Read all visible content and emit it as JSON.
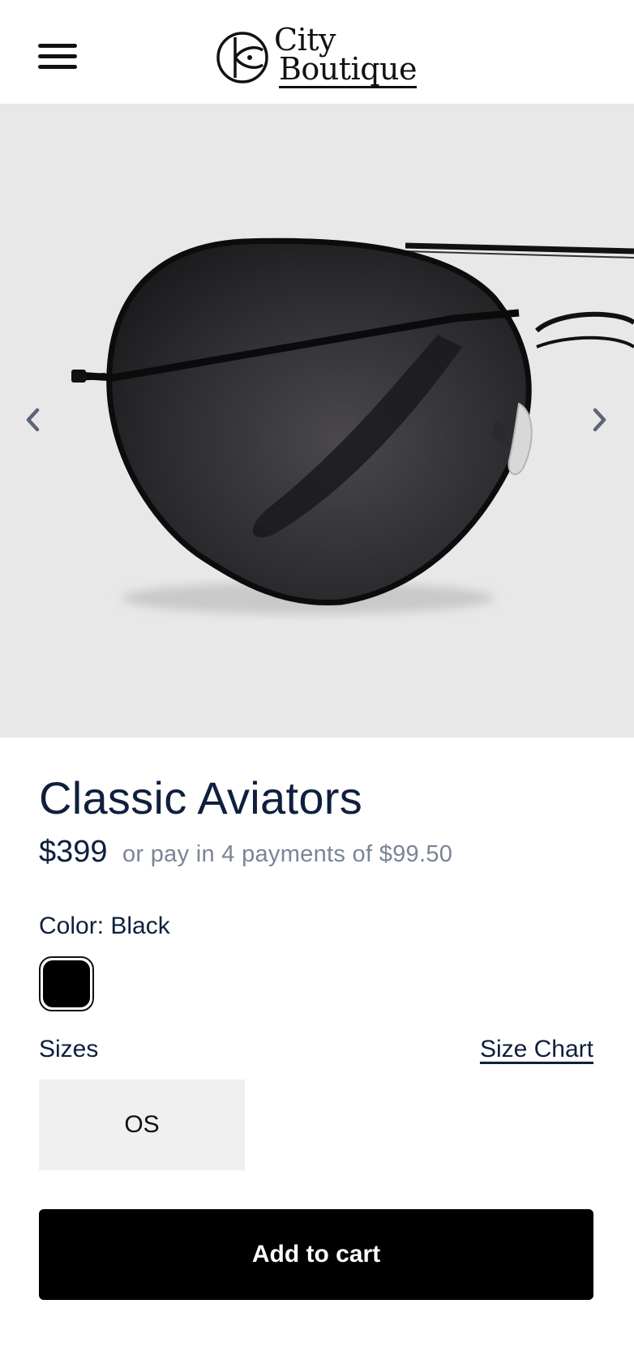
{
  "header": {
    "menu_icon": "hamburger-menu-icon",
    "logo": {
      "line1": "City",
      "line2": "Boutique"
    }
  },
  "gallery": {
    "image_alt": "Classic Aviators sunglasses",
    "prev_icon": "chevron-left-icon",
    "next_icon": "chevron-right-icon",
    "background_color": "#e8e8e8"
  },
  "product": {
    "title": "Classic Aviators",
    "price": "$399",
    "installments": "or pay in 4 payments of $99.50",
    "color_label": "Color: Black",
    "swatches": [
      {
        "color": "#000000",
        "selected": true
      }
    ],
    "sizes_label": "Sizes",
    "size_chart_link": "Size Chart",
    "sizes": [
      "OS"
    ],
    "add_to_cart": "Add to cart"
  },
  "colors": {
    "text_primary": "#0f1f3d",
    "text_muted": "#7a8496",
    "button_bg": "#000000",
    "size_bg": "#f0f0f0"
  }
}
